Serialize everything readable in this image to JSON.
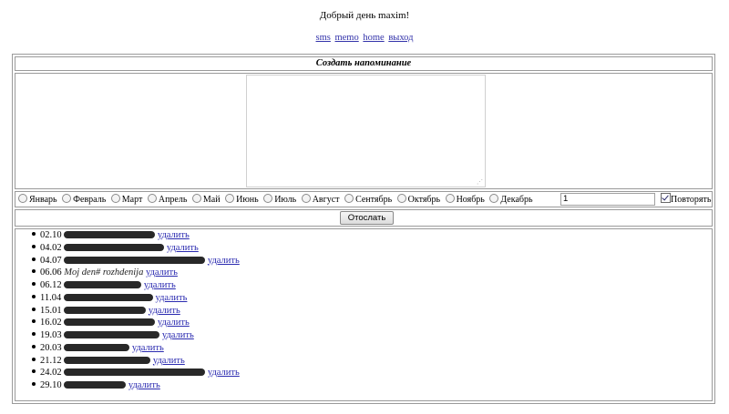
{
  "header": {
    "greeting": "Добрый день maxim!",
    "nav": [
      "sms",
      "memo",
      "home",
      "выход"
    ]
  },
  "form": {
    "title": "Создать напоминание",
    "months": [
      "Январь",
      "Февраль",
      "Март",
      "Апрель",
      "Май",
      "Июнь",
      "Июль",
      "Август",
      "Сентябрь",
      "Октябрь",
      "Ноябрь",
      "Декабрь"
    ],
    "day_value": "1",
    "repeat_label": "Повторять",
    "repeat_checked": true,
    "send_label": "Отослать"
  },
  "reminders": {
    "delete_label": "удалить",
    "items": [
      {
        "date": "02.10"
      },
      {
        "date": "04.02"
      },
      {
        "date": "04.07"
      },
      {
        "date": "06.06",
        "text": "Moj den# rozhdenija"
      },
      {
        "date": "06.12"
      },
      {
        "date": "11.04"
      },
      {
        "date": "15.01"
      },
      {
        "date": "16.02"
      },
      {
        "date": "19.03"
      },
      {
        "date": "20.03"
      },
      {
        "date": "21.12"
      },
      {
        "date": "24.02"
      },
      {
        "date": "29.10"
      }
    ]
  }
}
